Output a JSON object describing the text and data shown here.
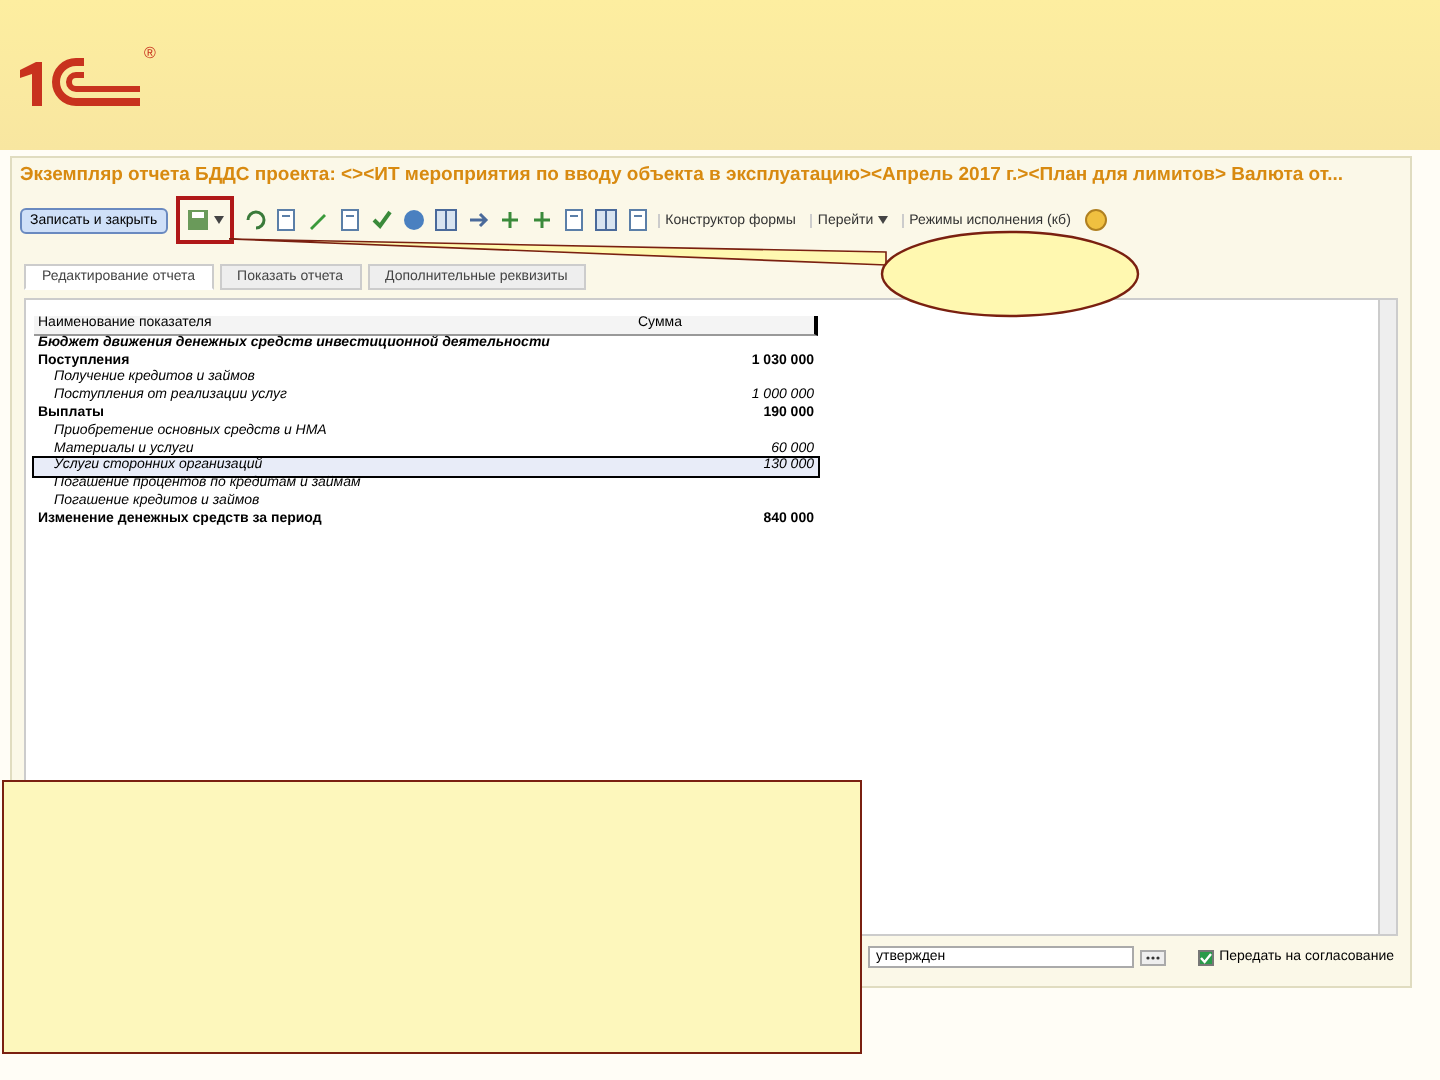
{
  "slide": {
    "registered_mark": "®"
  },
  "window": {
    "title": "Экземпляр отчета БДДС проекта: <><ИТ мероприятия по вводу объекта в эксплуатацию><Апрель 2017 г.><План для лимитов> Валюта от..."
  },
  "toolbar": [
    {
      "kind": "button",
      "label": "Записать и закрыть"
    },
    {
      "kind": "text",
      "label": "Конструктор формы"
    },
    {
      "kind": "menu",
      "label": "Перейти"
    },
    {
      "kind": "text",
      "label": "Режимы исполнения (кб)"
    }
  ],
  "tabs": [
    {
      "label": "Редактирование отчета",
      "selected": true
    },
    {
      "label": "Показать отчета",
      "selected": false
    },
    {
      "label": "Дополнительные реквизиты",
      "selected": false
    }
  ],
  "table": {
    "columns": [
      "Наименование показателя",
      "Сумма"
    ],
    "rows": [
      {
        "name": "Бюджет движения денежных средств инвестиционной деятельности",
        "amount": "",
        "kind": "section",
        "selected": false
      },
      {
        "name": "Поступления",
        "amount": "1 030 000",
        "kind": "group",
        "selected": false
      },
      {
        "name": "Получение кредитов и займов",
        "amount": "",
        "kind": "item",
        "selected": false
      },
      {
        "name": "Поступления от реализации услуг",
        "amount": "1 000 000",
        "kind": "item",
        "selected": false
      },
      {
        "name": "Выплаты",
        "amount": "190 000",
        "kind": "group",
        "selected": false
      },
      {
        "name": "Приобретение основных средств и НМА",
        "amount": "",
        "kind": "item",
        "selected": false
      },
      {
        "name": "Материалы и услуги",
        "amount": "60 000",
        "kind": "item",
        "selected": false
      },
      {
        "name": "Услуги сторонних организаций",
        "amount": "130 000",
        "kind": "item",
        "selected": true
      },
      {
        "name": "Погашение процентов по кредитам и займам",
        "amount": "",
        "kind": "item",
        "selected": false
      },
      {
        "name": "Погашение кредитов и займов",
        "amount": "",
        "kind": "item",
        "selected": false
      },
      {
        "name": "Изменение денежных средств за период",
        "amount": "840 000",
        "kind": "group",
        "selected": false
      }
    ]
  },
  "footer": {
    "status_value": "утвержден",
    "approve": {
      "label": "Передать на согласование",
      "checked": true
    }
  }
}
